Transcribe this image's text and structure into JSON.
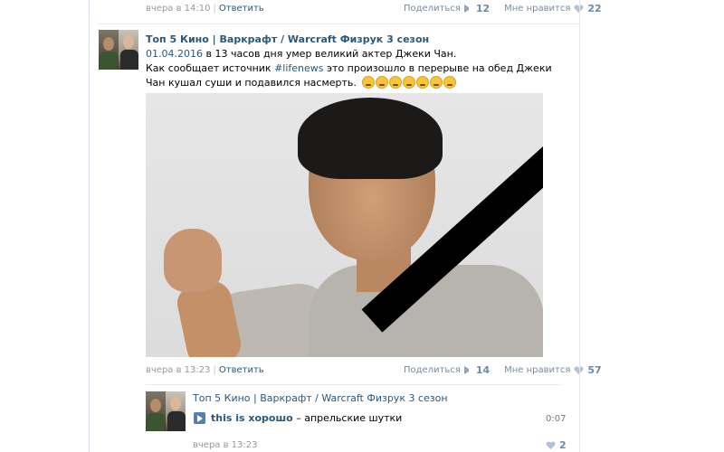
{
  "top_item": {
    "timestamp": "вчера в 14:10",
    "reply_label": "Ответить",
    "share_label": "Поделиться",
    "share_count": "12",
    "like_label": "Мне нравится",
    "like_count": "22"
  },
  "post": {
    "author": "Топ 5 Кино | Варкрафт / Warcraft Физрук 3 сезон",
    "date_link": "01.04.2016",
    "date_rest": " в 13 часов дня умер великий актер Джеки Чан.",
    "text_before": "Как сообщает источник ",
    "hashtag": "#lifenews",
    "text_after": " это произошло в перерыве на обед Джеки Чан кушал суши и подавился насмерть.",
    "timestamp": "вчера в 13:23",
    "reply_label": "Ответить",
    "share_label": "Поделиться",
    "share_count": "14",
    "like_label": "Мне нравится",
    "like_count": "57"
  },
  "comment": {
    "author": "Топ 5 Кино | Варкрафт / Warcraft Физрук 3 сезон",
    "track_title": "this is хорошо",
    "track_artist": "апрельские шутки",
    "duration": "0:07",
    "timestamp": "вчера в 13:23",
    "like_count": "2"
  }
}
